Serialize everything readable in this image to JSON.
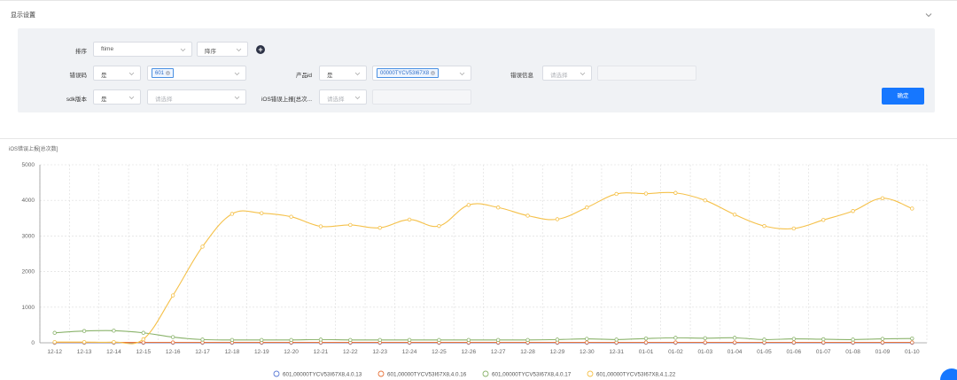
{
  "header": {
    "title": "显示设置",
    "collapse_icon": "chevron-down-icon"
  },
  "filters": {
    "sort_label": "排序",
    "sort_field": "ftime",
    "sort_order": "降序",
    "error_code_label": "错误码",
    "error_code_op": "是",
    "error_code_tag": "601",
    "product_id_label": "产品id",
    "product_id_op": "是",
    "product_id_tag": "00000TYCV53I67X8",
    "error_info_label": "错误信息",
    "error_info_placeholder": "请选择",
    "sdk_label": "sdk版本",
    "sdk_op": "是",
    "sdk_placeholder": "请选择",
    "ios_label": "iOS错误上报[总次...",
    "ios_placeholder": "请选择",
    "confirm_label": "确定"
  },
  "chart_title": "iOS错误上报[总次数]",
  "chart_data": {
    "type": "line",
    "title": "iOS错误上报[总次数]",
    "categories": [
      "12-12",
      "12-13",
      "12-14",
      "12-15",
      "12-16",
      "12-17",
      "12-18",
      "12-19",
      "12-20",
      "12-21",
      "12-22",
      "12-23",
      "12-24",
      "12-25",
      "12-26",
      "12-27",
      "12-28",
      "12-29",
      "12-30",
      "12-31",
      "01-01",
      "01-02",
      "01-03",
      "01-04",
      "01-05",
      "01-06",
      "01-07",
      "01-08",
      "01-09",
      "01-10"
    ],
    "ylim": [
      0,
      5000
    ],
    "yticks": [
      "0",
      "1000",
      "2000",
      "3000",
      "4000",
      "5000"
    ],
    "grid": true,
    "legend_position": "bottom",
    "series": [
      {
        "name": "601,00000TYCV53I67X8,4.0.13",
        "color": "#5b7bd5",
        "values": [
          0,
          0,
          0,
          0,
          0,
          0,
          0,
          0,
          0,
          0,
          0,
          0,
          0,
          0,
          0,
          0,
          0,
          0,
          0,
          0,
          0,
          0,
          0,
          0,
          0,
          0,
          0,
          0,
          0,
          0
        ]
      },
      {
        "name": "601,00000TYCV53I67X8,4.0.16",
        "color": "#e8743b",
        "values": [
          10,
          10,
          10,
          10,
          10,
          10,
          10,
          10,
          10,
          10,
          10,
          10,
          10,
          10,
          10,
          10,
          10,
          10,
          10,
          10,
          10,
          10,
          10,
          10,
          10,
          10,
          10,
          10,
          10,
          10
        ]
      },
      {
        "name": "601,00000TYCV53I67X8,4.0.17",
        "color": "#8ab36b",
        "values": [
          280,
          330,
          340,
          280,
          160,
          90,
          80,
          80,
          80,
          90,
          80,
          80,
          80,
          80,
          80,
          80,
          80,
          90,
          110,
          90,
          120,
          140,
          130,
          140,
          90,
          110,
          100,
          90,
          110,
          120
        ]
      },
      {
        "name": "601,00000TYCV53I67X8,4.1.22",
        "color": "#f5c14a",
        "values": [
          20,
          20,
          20,
          100,
          1330,
          2700,
          3620,
          3640,
          3540,
          3270,
          3310,
          3230,
          3460,
          3280,
          3870,
          3800,
          3570,
          3470,
          3800,
          4180,
          4190,
          4210,
          4000,
          3600,
          3280,
          3210,
          3450,
          3700,
          4060,
          3770
        ]
      }
    ]
  }
}
